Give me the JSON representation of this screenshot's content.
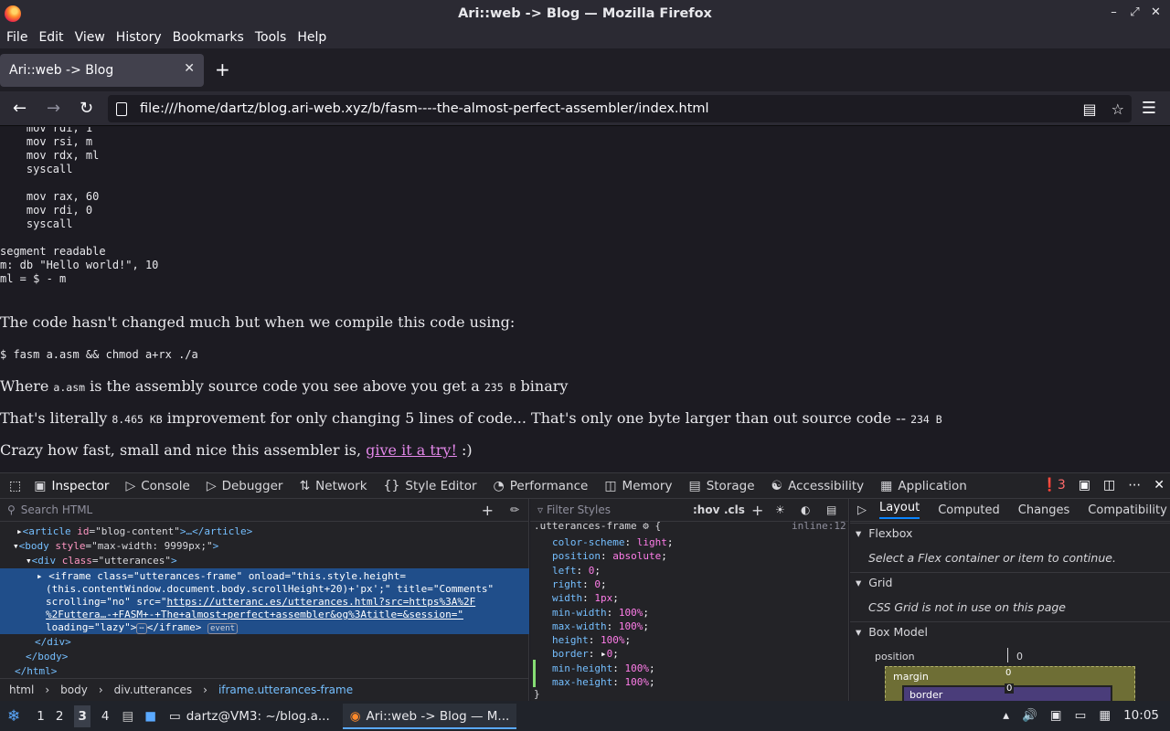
{
  "window": {
    "title": "Ari::web -> Blog — Mozilla Firefox",
    "controls": [
      "–",
      "⤢",
      "✕"
    ]
  },
  "menu": [
    "File",
    "Edit",
    "View",
    "History",
    "Bookmarks",
    "Tools",
    "Help"
  ],
  "tab": {
    "label": "Ari::web -> Blog",
    "close": "✕",
    "new": "+"
  },
  "nav": {
    "url": "file:///home/dartz/blog.ari-web.xyz/b/fasm----the-almost-perfect-assembler/index.html"
  },
  "page": {
    "code_top": [
      "    mov rdi, 1",
      "    mov rsi, m",
      "    mov rdx, ml",
      "    syscall",
      "",
      "    mov rax, 60",
      "    mov rdi, 0",
      "    syscall",
      "",
      "segment readable",
      "m: db \"Hello world!\", 10",
      "ml = $ - m"
    ],
    "p1": "The code hasn't changed much but when we compile this code using:",
    "cmd": "$ fasm a.asm && chmod a+rx ./a",
    "p2_a": "Where ",
    "p2_code1": "a.asm",
    "p2_b": " is the assembly source code you see above you get a ",
    "p2_code2": "235 B",
    "p2_c": " binary",
    "p3_a": "That's literally ",
    "p3_code1": "8.465 KB",
    "p3_b": " improvement for only changing 5 lines of code... That's only one byte larger than out source code -- ",
    "p3_code2": "234 B",
    "p4_a": "Crazy how fast, small and nice this assembler is, ",
    "p4_link": "give it a try!",
    "p4_b": " :)"
  },
  "devtools": {
    "tabs": [
      "Inspector",
      "Console",
      "Debugger",
      "Network",
      "Style Editor",
      "Performance",
      "Memory",
      "Storage",
      "Accessibility",
      "Application"
    ],
    "error_count": "3",
    "search_placeholder": "Search HTML",
    "markup": {
      "l1_tag": "<article ",
      "l1_attr": "id",
      "l1_val": "=\"blog-content\"",
      "l1_end": ">…</article>",
      "l2_tag": "<body ",
      "l2_attr": "style",
      "l2_val": "=\"max-width: 9999px;\"",
      "l2_end": ">",
      "l3_tag": "<div ",
      "l3_attr": "class",
      "l3_val": "=\"utterances\"",
      "l3_end": ">",
      "sel1": "<iframe class=\"utterances-frame\" onload=\"this.style.height=",
      "sel2": "(this.contentWindow.document.body.scrollHeight+20)+'px';\" title=\"Comments\"",
      "sel3_a": "scrolling=\"no\" src=\"",
      "sel3_link": "https://utteranc.es/utterances.html?src=https%3A%2F",
      "sel4": "%2Futtera…-+FASM+-+The+almost+perfect+assembler&og%3Atitle=&session=\"",
      "sel5_a": "loading=\"lazy\">",
      "sel5_b": "</iframe>",
      "event_badge": "event",
      "l_div_close": "</div>",
      "l_body_close": "</body>",
      "l_html_close": "</html>"
    },
    "breadcrumbs": [
      "html",
      "body",
      "div.utterances",
      "iframe.utterances-frame"
    ],
    "rules": {
      "filter": "Filter Styles",
      "hov": ":hov",
      "cls": ".cls",
      "selector": ".utterances-frame",
      "source": "inline:12",
      "props": [
        [
          "color-scheme",
          "light"
        ],
        [
          "position",
          "absolute"
        ],
        [
          "left",
          "0"
        ],
        [
          "right",
          "0"
        ],
        [
          "width",
          "1px"
        ],
        [
          "min-width",
          "100%"
        ],
        [
          "max-width",
          "100%"
        ],
        [
          "height",
          "100%"
        ],
        [
          "border",
          "0"
        ],
        [
          "min-height",
          "100%"
        ],
        [
          "max-height",
          "100%"
        ]
      ],
      "close": "}"
    },
    "layout": {
      "tabs": [
        "Layout",
        "Computed",
        "Changes",
        "Compatibility"
      ],
      "flexbox": "Flexbox",
      "flexbox_msg": "Select a Flex container or item to continue.",
      "grid": "Grid",
      "grid_msg": "CSS Grid is not in use on this page",
      "boxmodel": "Box Model",
      "position": "position",
      "pos_val": "0",
      "margin": "margin",
      "margin_val": "0",
      "border": "border",
      "border_val": "0"
    }
  },
  "taskbar": {
    "workspaces": [
      "1",
      "2",
      "3",
      "4"
    ],
    "win1": "dartz@VM3: ~/blog.a...",
    "win2": "Ari::web -> Blog — M...",
    "clock": "10:05"
  }
}
